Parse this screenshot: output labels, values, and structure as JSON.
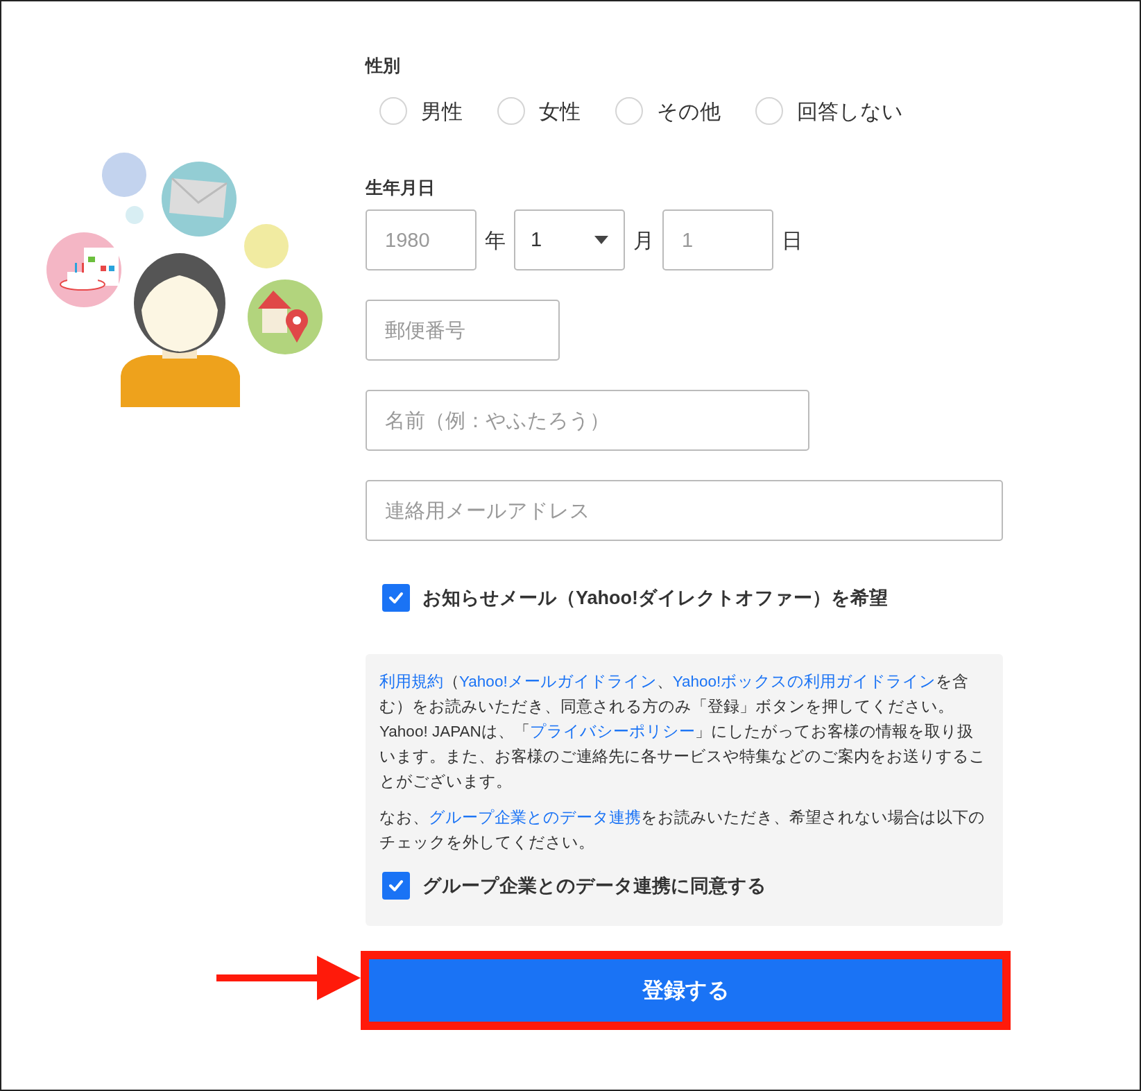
{
  "gender": {
    "label": "性別",
    "options": [
      {
        "label": "男性",
        "selected": false
      },
      {
        "label": "女性",
        "selected": false
      },
      {
        "label": "その他",
        "selected": false
      },
      {
        "label": "回答しない",
        "selected": false
      }
    ]
  },
  "birthday": {
    "label": "生年月日",
    "year": {
      "placeholder": "1980"
    },
    "year_unit": "年",
    "month": {
      "value": "1"
    },
    "month_unit": "月",
    "day": {
      "placeholder": "1"
    },
    "day_unit": "日"
  },
  "postal_code": {
    "placeholder": "郵便番号"
  },
  "name": {
    "placeholder": "名前（例：やふたろう）"
  },
  "email": {
    "placeholder": "連絡用メールアドレス"
  },
  "newsletter": {
    "label": "お知らせメール（Yahoo!ダイレクトオファー）を希望",
    "checked": true
  },
  "terms": {
    "paragraphs": [
      [
        {
          "text": "利用規約",
          "link": true
        },
        {
          "text": "（",
          "link": false
        },
        {
          "text": "Yahoo!メールガイドライン",
          "link": true
        },
        {
          "text": "、",
          "link": false
        },
        {
          "text": "Yahoo!ボックスの利用ガイドライン",
          "link": true
        },
        {
          "text": "を含む）をお読みいただき、同意される方のみ「登録」ボタンを押してください。Yahoo! JAPANは、「",
          "link": false
        },
        {
          "text": "プライバシーポリシー",
          "link": true
        },
        {
          "text": "」にしたがってお客様の情報を取り扱います。また、お客様のご連絡先に各サービスや特集などのご案内をお送りすることがございます。",
          "link": false
        }
      ],
      [
        {
          "text": "なお、",
          "link": false
        },
        {
          "text": "グループ企業とのデータ連携",
          "link": true
        },
        {
          "text": "をお読みいただき、希望されない場合は以下のチェックを外してください。",
          "link": false
        }
      ]
    ]
  },
  "group_consent": {
    "label": "グループ企業とのデータ連携に同意する",
    "checked": true
  },
  "submit": {
    "label": "登録する"
  }
}
